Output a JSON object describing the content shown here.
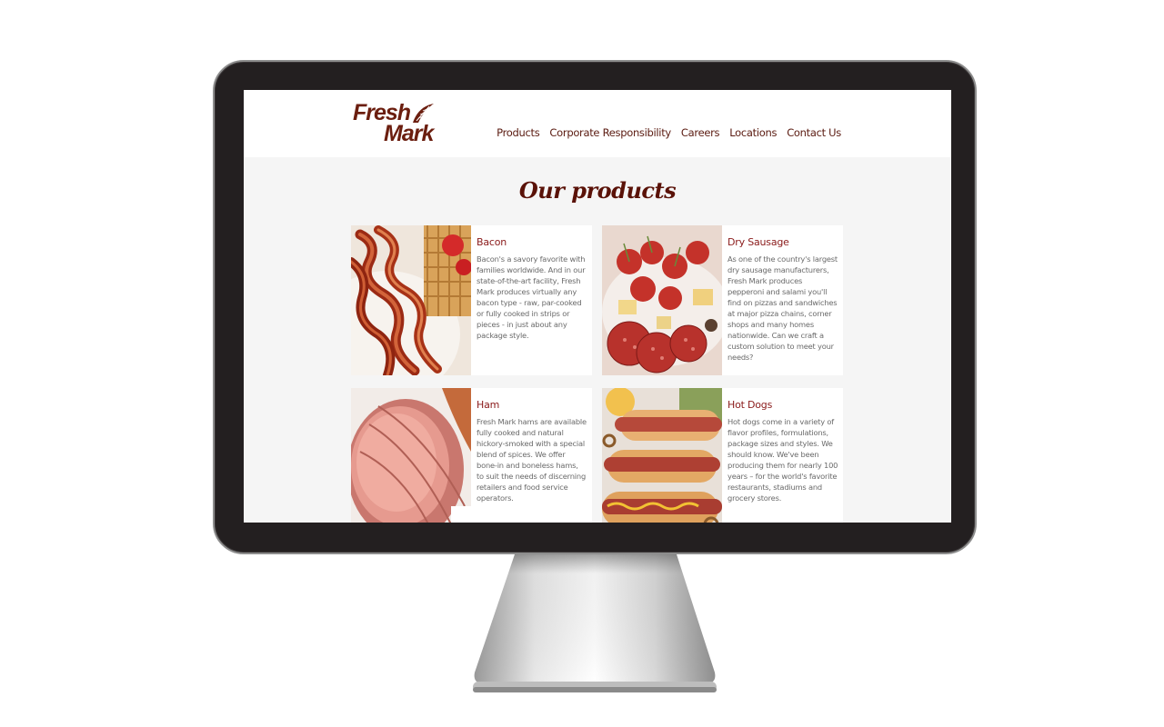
{
  "site": {
    "logo_line1": "Fresh",
    "logo_line2": "Mark",
    "nav": [
      "Products",
      "Corporate Responsibility",
      "Careers",
      "Locations",
      "Contact Us"
    ],
    "page_title": "Our products"
  },
  "products": [
    {
      "name": "Bacon",
      "description": "Bacon's a savory favorite with families worldwide. And in our state-of-the-art facility, Fresh Mark produces virtually any bacon type - raw, par-cooked or fully cooked in strips or pieces - in just about any package style."
    },
    {
      "name": "Dry Sausage",
      "description": "As one of the country's largest dry sausage manufacturers, Fresh Mark produces pepperoni and salami you'll find on pizzas and sandwiches at major pizza chains, corner shops and many homes nationwide. Can we craft a custom solution to meet your needs?"
    },
    {
      "name": "Ham",
      "description": "Fresh Mark hams are available fully cooked and natural hickory-smoked with a special blend of spices. We offer bone-in and boneless hams, to suit the needs of discerning retailers and food service operators."
    },
    {
      "name": "Hot Dogs",
      "description": "Hot dogs come in a variety of flavor profiles, formulations, package sizes and styles. We should know. We've been producing them for nearly 100 years – for the world's favorite restaurants, stadiums and grocery stores."
    }
  ],
  "colors": {
    "brand": "#6b1e0f",
    "heading": "#5a1208",
    "card_title": "#8a1a1a",
    "monitor_bezel": "#231f20"
  }
}
